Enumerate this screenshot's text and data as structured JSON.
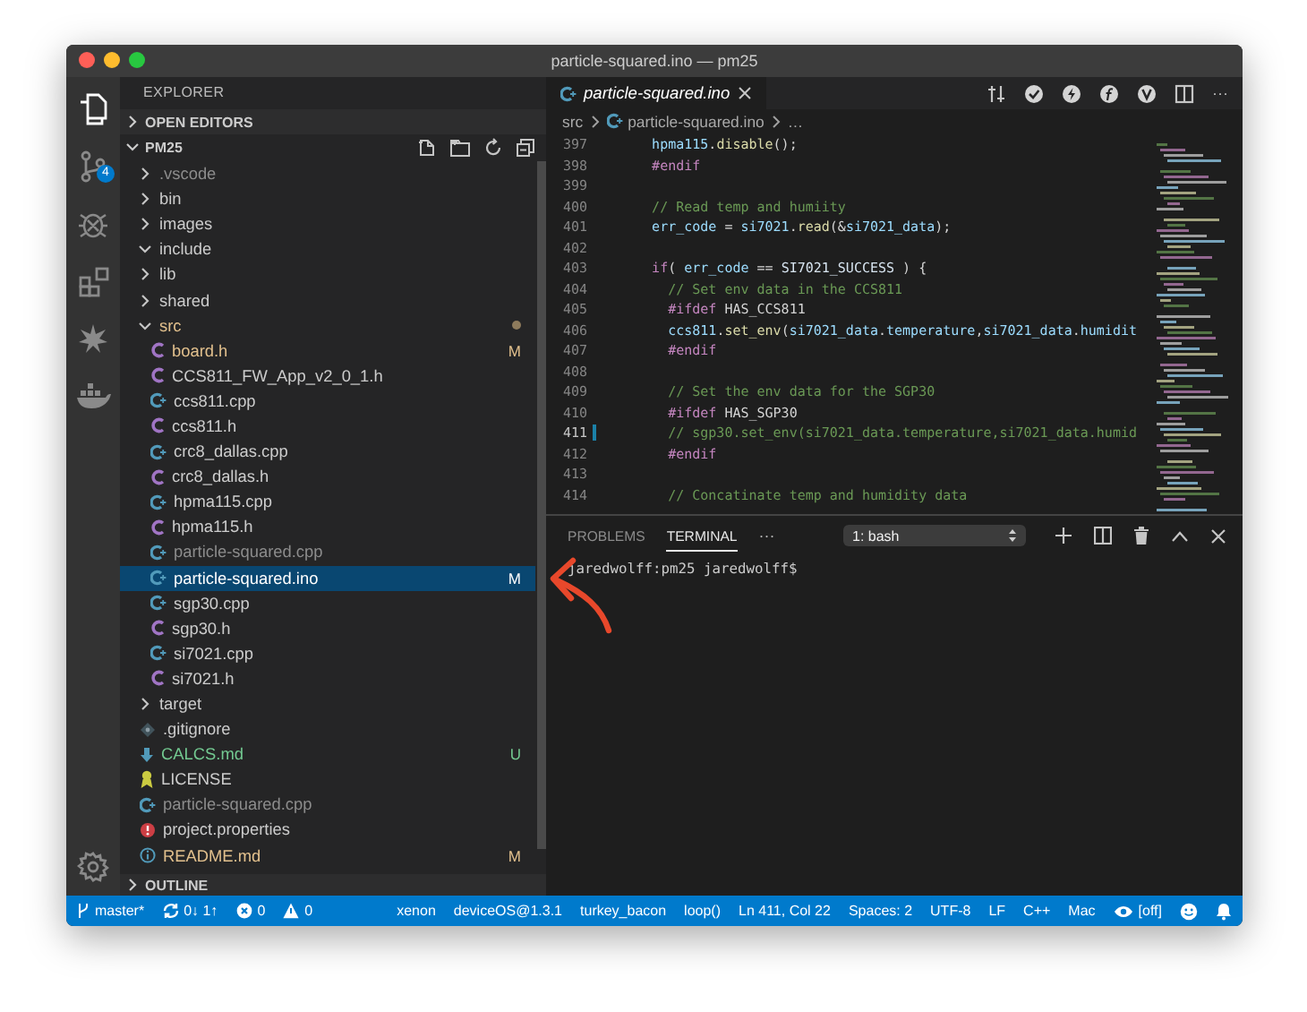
{
  "window": {
    "title": "particle-squared.ino — pm25"
  },
  "activity_bar": {
    "items": [
      {
        "kind": "files",
        "selected": true
      },
      {
        "kind": "source-control",
        "selected": false,
        "badge": "4"
      },
      {
        "kind": "debug",
        "selected": false
      },
      {
        "kind": "extensions",
        "selected": false
      },
      {
        "kind": "particle",
        "selected": false
      },
      {
        "kind": "docker",
        "selected": false
      }
    ],
    "bottom": [
      {
        "kind": "settings"
      }
    ]
  },
  "sidebar": {
    "title": "EXPLORER",
    "open_editors": {
      "label": "OPEN EDITORS",
      "expanded": false
    },
    "project": {
      "label": "PM25",
      "expanded": true,
      "tree": [
        {
          "name": ".vscode",
          "kind": "folder",
          "expanded": false,
          "dot": false,
          "color": "#8c8c8c",
          "selected": false
        },
        {
          "name": "bin",
          "kind": "folder",
          "expanded": false,
          "dot": false,
          "selected": false
        },
        {
          "name": "images",
          "kind": "folder",
          "expanded": false,
          "dot": false,
          "selected": false
        },
        {
          "name": "include",
          "kind": "folder",
          "expanded": true,
          "dot": false,
          "selected": false
        },
        {
          "name": "lib",
          "kind": "folder",
          "expanded": false,
          "dot": false,
          "selected": false
        },
        {
          "name": "shared",
          "kind": "folder",
          "expanded": false,
          "dot": false,
          "selected": false
        },
        {
          "name": "src",
          "kind": "folder",
          "expanded": true,
          "dot": true,
          "color": "#e2c08d",
          "selected": false,
          "children": [
            {
              "name": "board.h",
              "kind": "c-header",
              "color": "#e2c08d",
              "badge": "M",
              "selected": false
            },
            {
              "name": "CCS811_FW_App_v2_0_1.h",
              "kind": "c-header",
              "selected": false
            },
            {
              "name": "ccs811.cpp",
              "kind": "cpp",
              "selected": false
            },
            {
              "name": "ccs811.h",
              "kind": "c-header",
              "selected": false
            },
            {
              "name": "crc8_dallas.cpp",
              "kind": "cpp",
              "selected": false
            },
            {
              "name": "crc8_dallas.h",
              "kind": "c-header",
              "selected": false
            },
            {
              "name": "hpma115.cpp",
              "kind": "cpp",
              "selected": false
            },
            {
              "name": "hpma115.h",
              "kind": "c-header",
              "selected": false
            },
            {
              "name": "particle-squared.cpp",
              "kind": "cpp",
              "color": "#8c8c8c",
              "selected": false
            },
            {
              "name": "particle-squared.ino",
              "kind": "cpp",
              "badge": "M",
              "selected": true
            },
            {
              "name": "sgp30.cpp",
              "kind": "cpp",
              "selected": false
            },
            {
              "name": "sgp30.h",
              "kind": "c-header",
              "selected": false
            },
            {
              "name": "si7021.cpp",
              "kind": "cpp",
              "selected": false
            },
            {
              "name": "si7021.h",
              "kind": "c-header",
              "selected": false
            }
          ]
        },
        {
          "name": "target",
          "kind": "folder",
          "expanded": false,
          "dot": false,
          "selected": false
        },
        {
          "name": ".gitignore",
          "kind": "git",
          "selected": false
        },
        {
          "name": "CALCS.md",
          "kind": "markdown",
          "color": "#73c991",
          "badge": "U",
          "selected": false
        },
        {
          "name": "LICENSE",
          "kind": "license",
          "selected": false
        },
        {
          "name": "particle-squared.cpp",
          "kind": "cpp",
          "color": "#8c8c8c",
          "selected": false
        },
        {
          "name": "project.properties",
          "kind": "properties",
          "selected": false
        },
        {
          "name": "README.md",
          "kind": "info",
          "color": "#e2c08d",
          "badge": "M",
          "selected": false
        }
      ]
    },
    "outline": {
      "label": "OUTLINE",
      "expanded": false
    }
  },
  "editor": {
    "tab": {
      "label": "particle-squared.ino",
      "selected": true
    },
    "more": "···",
    "breadcrumbs": {
      "folder": "src",
      "file": "particle-squared.ino",
      "rest": "…"
    },
    "lines": [
      {
        "number": "397",
        "current": false,
        "changed": false,
        "tokens": [
          {
            "text": "    hpma115",
            "kind": "var"
          },
          {
            "text": ".",
            "kind": "plain"
          },
          {
            "text": "disable",
            "kind": "func"
          },
          {
            "text": "();",
            "kind": "plain"
          }
        ]
      },
      {
        "number": "398",
        "current": false,
        "changed": false,
        "tokens": [
          {
            "text": "    #endif",
            "kind": "dir"
          }
        ]
      },
      {
        "number": "399",
        "current": false,
        "changed": false
      },
      {
        "number": "400",
        "current": false,
        "changed": false,
        "tokens": [
          {
            "text": "    // Read temp and humiity",
            "kind": "com"
          }
        ]
      },
      {
        "number": "401",
        "current": false,
        "changed": false,
        "tokens": [
          {
            "text": "    err_code",
            "kind": "var"
          },
          {
            "text": " = ",
            "kind": "plain"
          },
          {
            "text": "si7021",
            "kind": "var"
          },
          {
            "text": ".",
            "kind": "plain"
          },
          {
            "text": "read",
            "kind": "func"
          },
          {
            "text": "(&",
            "kind": "plain"
          },
          {
            "text": "si7021_data",
            "kind": "var"
          },
          {
            "text": ");",
            "kind": "plain"
          }
        ]
      },
      {
        "number": "402",
        "current": false,
        "changed": false
      },
      {
        "number": "403",
        "current": false,
        "changed": false,
        "tokens": [
          {
            "text": "    if",
            "kind": "dir"
          },
          {
            "text": "( ",
            "kind": "plain"
          },
          {
            "text": "err_code",
            "kind": "var"
          },
          {
            "text": " == ",
            "kind": "plain"
          },
          {
            "text": "SI7021_SUCCESS",
            "kind": "const"
          },
          {
            "text": " ) {",
            "kind": "plain"
          }
        ]
      },
      {
        "number": "404",
        "current": false,
        "changed": false,
        "tokens": [
          {
            "text": "      // Set env data in the CCS811",
            "kind": "com"
          }
        ]
      },
      {
        "number": "405",
        "current": false,
        "changed": false,
        "tokens": [
          {
            "text": "      #ifdef",
            "kind": "dir"
          },
          {
            "text": " HAS_CCS811",
            "kind": "plain"
          }
        ]
      },
      {
        "number": "406",
        "current": false,
        "changed": false,
        "tokens": [
          {
            "text": "      ccs811",
            "kind": "var"
          },
          {
            "text": ".",
            "kind": "plain"
          },
          {
            "text": "set_env",
            "kind": "func"
          },
          {
            "text": "(",
            "kind": "plain"
          },
          {
            "text": "si7021_data",
            "kind": "var"
          },
          {
            "text": ".",
            "kind": "plain"
          },
          {
            "text": "temperature",
            "kind": "var"
          },
          {
            "text": ",",
            "kind": "plain"
          },
          {
            "text": "si7021_data",
            "kind": "var"
          },
          {
            "text": ".",
            "kind": "plain"
          },
          {
            "text": "humidit",
            "kind": "var"
          }
        ]
      },
      {
        "number": "407",
        "current": false,
        "changed": false,
        "tokens": [
          {
            "text": "      #endif",
            "kind": "dir"
          }
        ]
      },
      {
        "number": "408",
        "current": false,
        "changed": false
      },
      {
        "number": "409",
        "current": false,
        "changed": false,
        "tokens": [
          {
            "text": "      // Set the env data for the SGP30",
            "kind": "com"
          }
        ]
      },
      {
        "number": "410",
        "current": false,
        "changed": false,
        "tokens": [
          {
            "text": "      #ifdef",
            "kind": "dir"
          },
          {
            "text": " HAS_SGP30",
            "kind": "plain"
          }
        ]
      },
      {
        "number": "411",
        "current": true,
        "changed": true,
        "tokens": [
          {
            "text": "      // sgp30.set_env(si7021_data.temperature,si7021_data.humid",
            "kind": "com"
          }
        ]
      },
      {
        "number": "412",
        "current": false,
        "changed": false,
        "tokens": [
          {
            "text": "      #endif",
            "kind": "dir"
          }
        ]
      },
      {
        "number": "413",
        "current": false,
        "changed": false
      },
      {
        "number": "414",
        "current": false,
        "changed": false,
        "tokens": [
          {
            "text": "      // Concatinate temp and humidity data",
            "kind": "com"
          }
        ]
      }
    ]
  },
  "panel": {
    "tabs": [
      {
        "label": "PROBLEMS",
        "selected": false
      },
      {
        "label": "TERMINAL",
        "selected": true
      }
    ],
    "more": "···",
    "terminal_select": "1: bash",
    "terminal_lines": [
      "jaredwolff:pm25 jaredwolff$"
    ]
  },
  "status_bar": {
    "left": [
      {
        "kind": "branch",
        "text": "master*"
      },
      {
        "kind": "sync",
        "text": "0↓ 1↑"
      },
      {
        "kind": "error",
        "text": "0"
      },
      {
        "kind": "warning",
        "text": "0"
      }
    ],
    "right": [
      {
        "text": "xenon"
      },
      {
        "text": "deviceOS@1.3.1"
      },
      {
        "text": "turkey_bacon"
      },
      {
        "text": "loop()"
      },
      {
        "text": "Ln 411, Col 22"
      },
      {
        "text": "Spaces: 2"
      },
      {
        "text": "UTF-8"
      },
      {
        "text": "LF"
      },
      {
        "text": "C++"
      },
      {
        "text": "Mac"
      },
      {
        "kind": "eye",
        "text": "[off]"
      },
      {
        "kind": "smiley"
      },
      {
        "kind": "bell"
      }
    ]
  }
}
